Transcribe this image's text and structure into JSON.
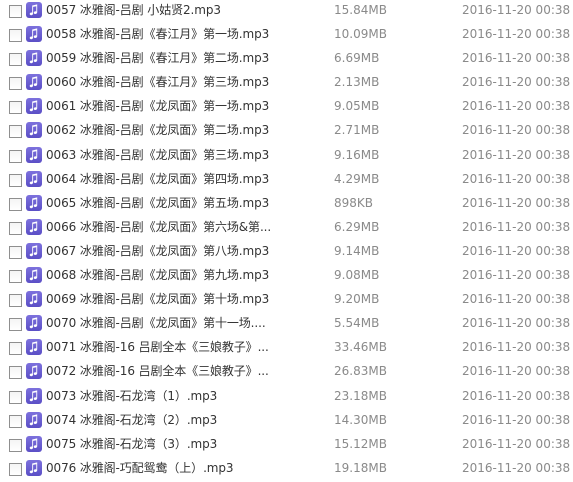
{
  "files": [
    {
      "name": "0057 冰雅阁-吕剧 小姑贤2.mp3",
      "size": "15.84MB",
      "date": "2016-11-20 00:38"
    },
    {
      "name": "0058 冰雅阁-吕剧《春江月》第一场.mp3",
      "size": "10.09MB",
      "date": "2016-11-20 00:38"
    },
    {
      "name": "0059 冰雅阁-吕剧《春江月》第二场.mp3",
      "size": "6.69MB",
      "date": "2016-11-20 00:38"
    },
    {
      "name": "0060 冰雅阁-吕剧《春江月》第三场.mp3",
      "size": "2.13MB",
      "date": "2016-11-20 00:38"
    },
    {
      "name": "0061 冰雅阁-吕剧《龙凤面》第一场.mp3",
      "size": "9.05MB",
      "date": "2016-11-20 00:38"
    },
    {
      "name": "0062 冰雅阁-吕剧《龙凤面》第二场.mp3",
      "size": "2.71MB",
      "date": "2016-11-20 00:38"
    },
    {
      "name": "0063 冰雅阁-吕剧《龙凤面》第三场.mp3",
      "size": "9.16MB",
      "date": "2016-11-20 00:38"
    },
    {
      "name": "0064 冰雅阁-吕剧《龙凤面》第四场.mp3",
      "size": "4.29MB",
      "date": "2016-11-20 00:38"
    },
    {
      "name": "0065 冰雅阁-吕剧《龙凤面》第五场.mp3",
      "size": "898KB",
      "date": "2016-11-20 00:38"
    },
    {
      "name": "0066 冰雅阁-吕剧《龙凤面》第六场&第...",
      "size": "6.29MB",
      "date": "2016-11-20 00:38"
    },
    {
      "name": "0067 冰雅阁-吕剧《龙凤面》第八场.mp3",
      "size": "9.14MB",
      "date": "2016-11-20 00:38"
    },
    {
      "name": "0068 冰雅阁-吕剧《龙凤面》第九场.mp3",
      "size": "9.08MB",
      "date": "2016-11-20 00:38"
    },
    {
      "name": "0069 冰雅阁-吕剧《龙凤面》第十场.mp3",
      "size": "9.20MB",
      "date": "2016-11-20 00:38"
    },
    {
      "name": "0070 冰雅阁-吕剧《龙凤面》第十一场....",
      "size": "5.54MB",
      "date": "2016-11-20 00:38"
    },
    {
      "name": "0071 冰雅阁-16 吕剧全本《三娘教子》...",
      "size": "33.46MB",
      "date": "2016-11-20 00:38"
    },
    {
      "name": "0072 冰雅阁-16 吕剧全本《三娘教子》...",
      "size": "26.83MB",
      "date": "2016-11-20 00:38"
    },
    {
      "name": "0073 冰雅阁-石龙湾（1）.mp3",
      "size": "23.18MB",
      "date": "2016-11-20 00:38"
    },
    {
      "name": "0074 冰雅阁-石龙湾（2）.mp3",
      "size": "14.30MB",
      "date": "2016-11-20 00:38"
    },
    {
      "name": "0075 冰雅阁-石龙湾（3）.mp3",
      "size": "15.12MB",
      "date": "2016-11-20 00:38"
    },
    {
      "name": "0076 冰雅阁-巧配鸳鸯（上）.mp3",
      "size": "19.18MB",
      "date": "2016-11-20 00:38"
    }
  ],
  "icons": {
    "file": "music-note-icon",
    "checkbox": "checkbox-unchecked"
  },
  "colors": {
    "icon_bg": "#6a5fd3",
    "text": "#333333",
    "meta": "#8a8a8a"
  }
}
